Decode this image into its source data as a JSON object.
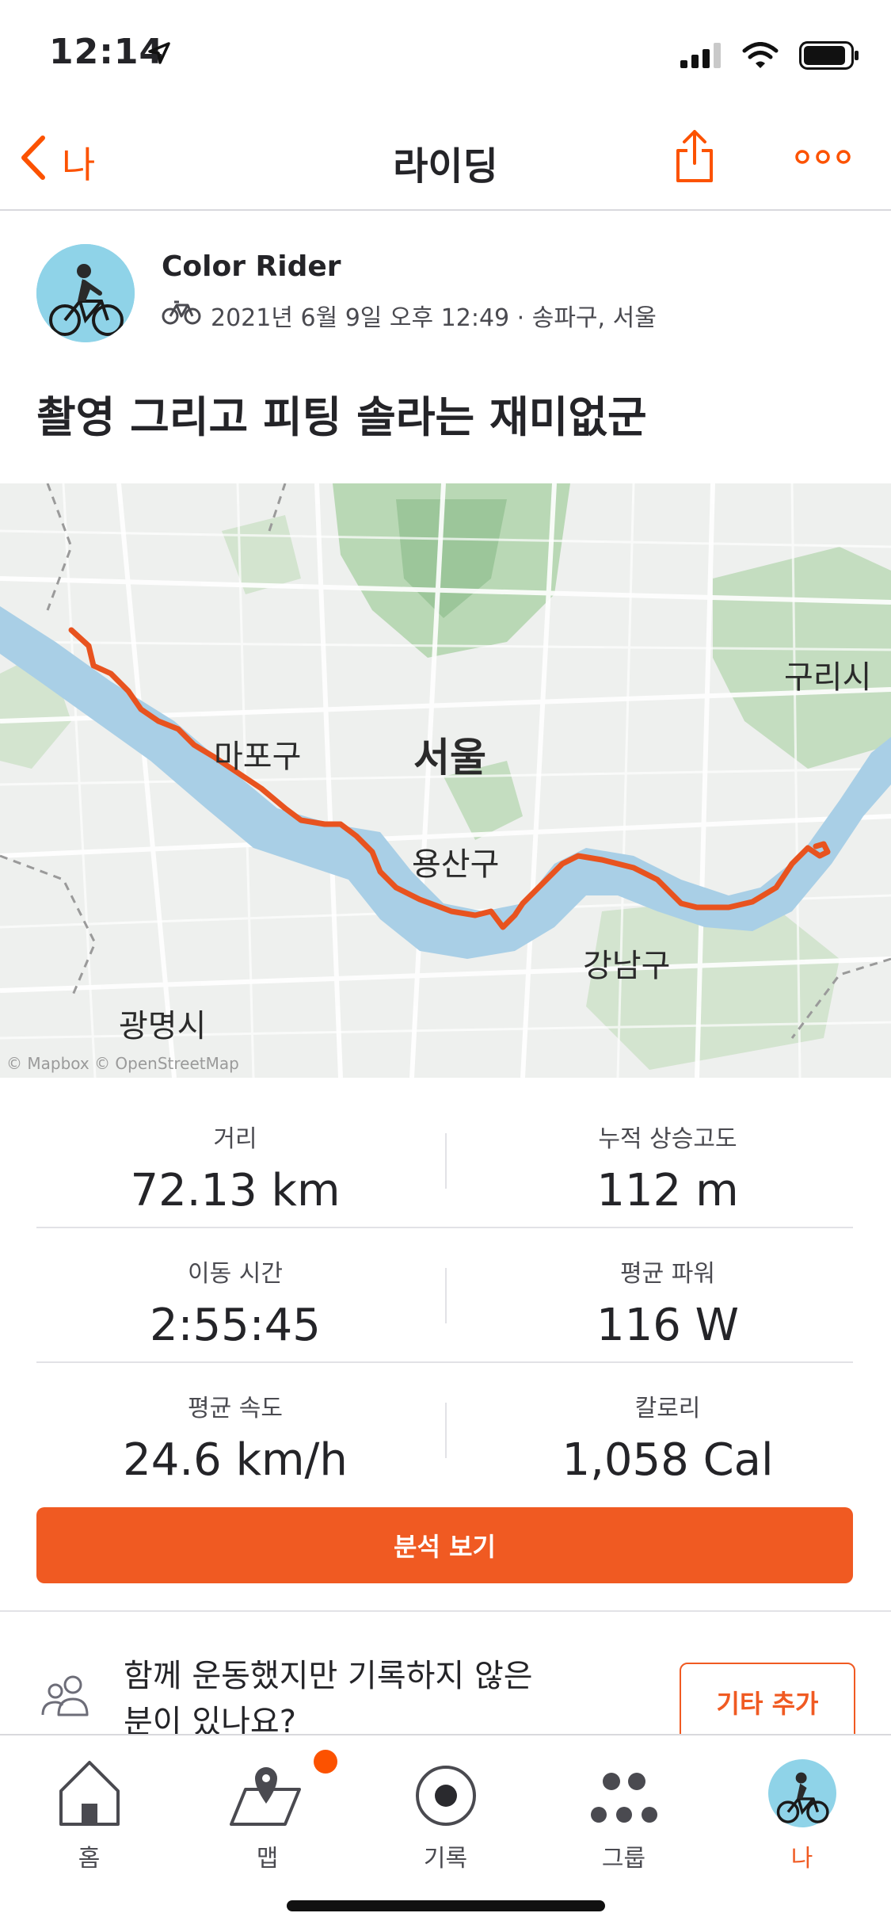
{
  "status_bar": {
    "time": "12:14"
  },
  "nav": {
    "back_label": "나",
    "title": "라이딩"
  },
  "athlete": {
    "name": "Color Rider",
    "activity_meta": "2021년 6월 9일 오후 12:49 · 송파구, 서울"
  },
  "activity": {
    "title": "촬영 그리고 피팅 솔라는 재미없군"
  },
  "map": {
    "labels": {
      "guri": "구리시",
      "mapo": "마포구",
      "seoul": "서울",
      "yongsan": "용산구",
      "gangnam": "강남구",
      "gwangmyeong": "광명시"
    },
    "attribution": "© Mapbox © OpenStreetMap",
    "route_color": "#e8531f",
    "river_color": "#a9cfe6"
  },
  "stats": [
    {
      "label": "거리",
      "value": "72.13 km"
    },
    {
      "label": "누적 상승고도",
      "value": "112 m"
    },
    {
      "label": "이동 시간",
      "value": "2:55:45"
    },
    {
      "label": "평균 파워",
      "value": "116 W"
    },
    {
      "label": "평균 속도",
      "value": "24.6 km/h"
    },
    {
      "label": "칼로리",
      "value": "1,058 Cal"
    }
  ],
  "analyze_button": "분석 보기",
  "together": {
    "text": "함께 운동했지만 기록하지 않은 분이 있나요?",
    "add_button": "기타 추가"
  },
  "tabs": [
    {
      "label": "홈",
      "icon": "home-icon"
    },
    {
      "label": "맵",
      "icon": "map-icon"
    },
    {
      "label": "기록",
      "icon": "record-icon"
    },
    {
      "label": "그룹",
      "icon": "groups-icon"
    },
    {
      "label": "나",
      "icon": "avatar-icon"
    }
  ],
  "colors": {
    "accent": "#fc5200",
    "button": "#f05a22"
  }
}
